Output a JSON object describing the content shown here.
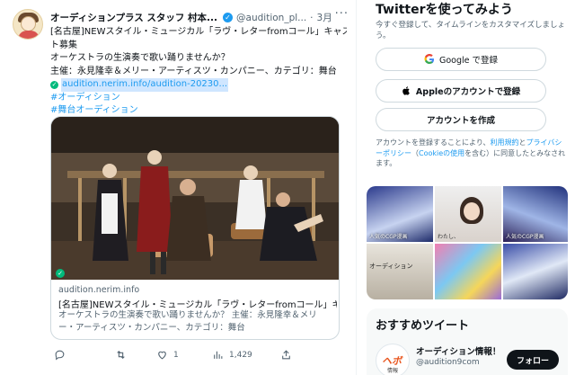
{
  "tweet": {
    "author_name": "オーディションプラス スタッフ 村本...",
    "handle": "@audition_pl...",
    "dot": "·",
    "time": "3月",
    "more": "···",
    "lines": [
      "[名古屋]NEWスタイル・ミュージカル「ラヴ・レターfromコール」キャス",
      "ト募集",
      "オーケストラの生演奏で歌い踊りませんか？",
      "主催：永見隆幸＆メリー・アーティスツ・カンパニー、カテゴリ：舞台"
    ],
    "url": "audition.nerim.info/audition-20230...",
    "hashtags": [
      "#オーディション",
      "#舞台オーディション"
    ],
    "card": {
      "domain": "audition.nerim.info",
      "title": "[名古屋]NEWスタイル・ミュージカル「ラヴ・レターfromコール」キ...",
      "description": "オーケストラの生演奏で歌い踊りませんか？ 主催：永見隆幸＆メリー・アーティスツ・カンパニー、カテゴリ：舞台"
    },
    "actions": {
      "reply_count": "",
      "retweet_count": "",
      "like_count": "1",
      "views_count": "1,429"
    }
  },
  "sidebar": {
    "title": "Twitterを使ってみよう",
    "subtitle": "今すぐ登録して、タイムラインをカスタマイズしましょう。",
    "google_button": "Google で登録",
    "apple_button": "Appleのアカウントで登録",
    "create_button": "アカウントを作成",
    "legal_pre": "アカウントを登録することにより、",
    "legal_terms": "利用規約",
    "legal_and": "と",
    "legal_privacy": "プライバシーポリシー",
    "legal_paren_open": "（",
    "legal_cookie": "Cookieの使用",
    "legal_post": "を含む）に同意したとみなされます。",
    "media_tiles": [
      {
        "caption": "人気のCGP漫画"
      },
      {
        "caption": "わたし、"
      },
      {
        "caption": "人気のCGP漫画"
      },
      {
        "caption": "オーディション"
      },
      {
        "caption": ""
      },
      {
        "caption": ""
      }
    ],
    "recommend_title": "おすすめツイート",
    "recommend_name": "オーディション情報！",
    "recommend_handle": "@audition9com",
    "recommend_logo": "ヘボ",
    "recommend_logo_sub": "情報",
    "follow_label": "フォロー"
  },
  "colors": {
    "accent": "#1d9bf0",
    "verified": "#1d9bf0",
    "check": "#00ba7c",
    "follow_bg": "#0f1419"
  }
}
